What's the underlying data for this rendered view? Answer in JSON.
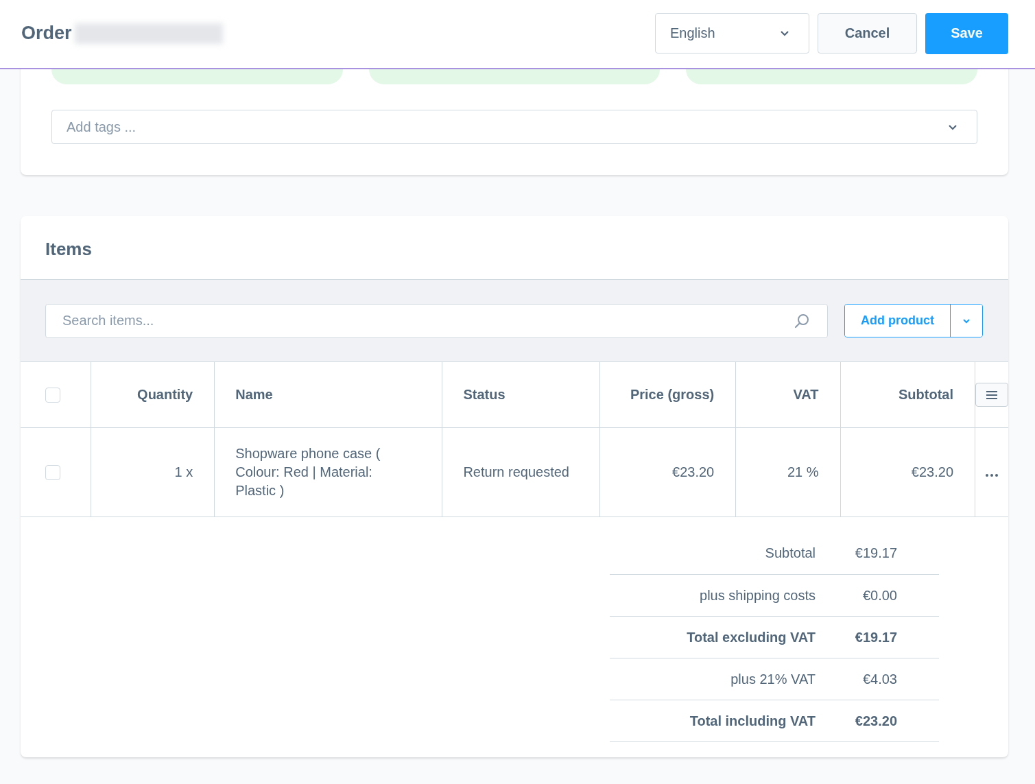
{
  "header": {
    "title": "Order",
    "language": "English",
    "cancel": "Cancel",
    "save": "Save"
  },
  "tags": {
    "placeholder": "Add tags ..."
  },
  "items": {
    "title": "Items",
    "search": {
      "placeholder": "Search items..."
    },
    "add_button": "Add product",
    "select_all": {
      "checked": false
    },
    "columns": [
      "Quantity",
      "Name",
      "Status",
      "Price (gross)",
      "VAT",
      "Subtotal"
    ],
    "rows": [
      {
        "checked": false,
        "cells": [
          "1 x",
          "Shopware phone case ( Colour: Red | Material: Plastic )",
          "Return requested",
          "€23.20",
          "21 %",
          "€23.20"
        ]
      }
    ]
  },
  "summary": [
    {
      "label": "Subtotal",
      "value": "€19.17",
      "bold": false
    },
    {
      "label": "plus shipping costs",
      "value": "€0.00",
      "bold": false
    },
    {
      "label": "Total excluding VAT",
      "value": "€19.17",
      "bold": true
    },
    {
      "label": "plus 21% VAT",
      "value": "€4.03",
      "bold": false
    },
    {
      "label": "Total including VAT",
      "value": "€23.20",
      "bold": true
    }
  ]
}
